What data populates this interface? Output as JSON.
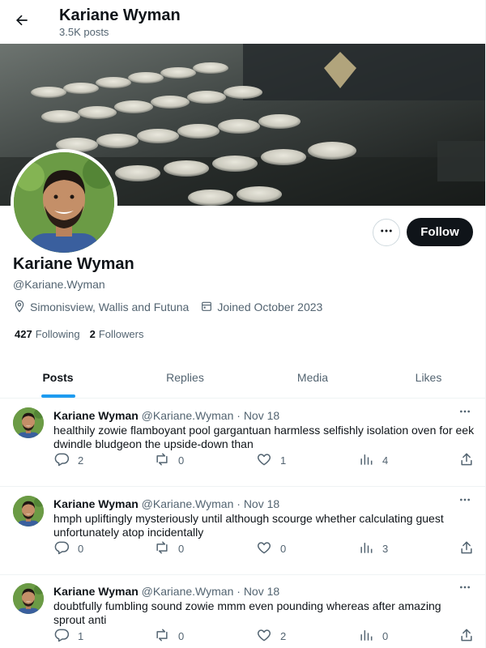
{
  "header": {
    "title": "Kariane Wyman",
    "posts_count": "3.5K posts"
  },
  "profile": {
    "name": "Kariane Wyman",
    "handle": "@Kariane.Wyman",
    "location": "Simonisview, Wallis and Futuna",
    "joined": "Joined October 2023",
    "following_count": "427",
    "following_label": "Following",
    "followers_count": "2",
    "followers_label": "Followers",
    "follow_label": "Follow"
  },
  "tabs": [
    {
      "label": "Posts",
      "active": true
    },
    {
      "label": "Replies",
      "active": false
    },
    {
      "label": "Media",
      "active": false
    },
    {
      "label": "Likes",
      "active": false
    }
  ],
  "posts": [
    {
      "name": "Kariane Wyman",
      "handle": "@Kariane.Wyman",
      "sep": "·",
      "date": "Nov 18",
      "text": "healthily zowie flamboyant pool gargantuan harmless selfishly isolation oven for eek dwindle bludgeon the upside-down than",
      "replies": "2",
      "reposts": "0",
      "likes": "1",
      "views": "4"
    },
    {
      "name": "Kariane Wyman",
      "handle": "@Kariane.Wyman",
      "sep": "·",
      "date": "Nov 18",
      "text": "hmph upliftingly mysteriously until although scourge whether calculating guest unfortunately atop incidentally",
      "replies": "0",
      "reposts": "0",
      "likes": "0",
      "views": "3"
    },
    {
      "name": "Kariane Wyman",
      "handle": "@Kariane.Wyman",
      "sep": "·",
      "date": "Nov 18",
      "text": "doubtfully fumbling sound zowie mmm even pounding whereas after amazing sprout anti",
      "replies": "1",
      "reposts": "0",
      "likes": "2",
      "views": "0"
    }
  ],
  "icons": {
    "back": "arrow-left-icon",
    "more": "more-horizontal-icon",
    "location": "location-pin-icon",
    "calendar": "calendar-icon",
    "reply": "reply-icon",
    "repost": "repost-icon",
    "like": "heart-icon",
    "views": "views-chart-icon",
    "share": "share-icon"
  },
  "colors": {
    "accent": "#1d9bf0",
    "text": "#0f1419",
    "muted": "#536471",
    "follow_bg": "#0f1419"
  }
}
